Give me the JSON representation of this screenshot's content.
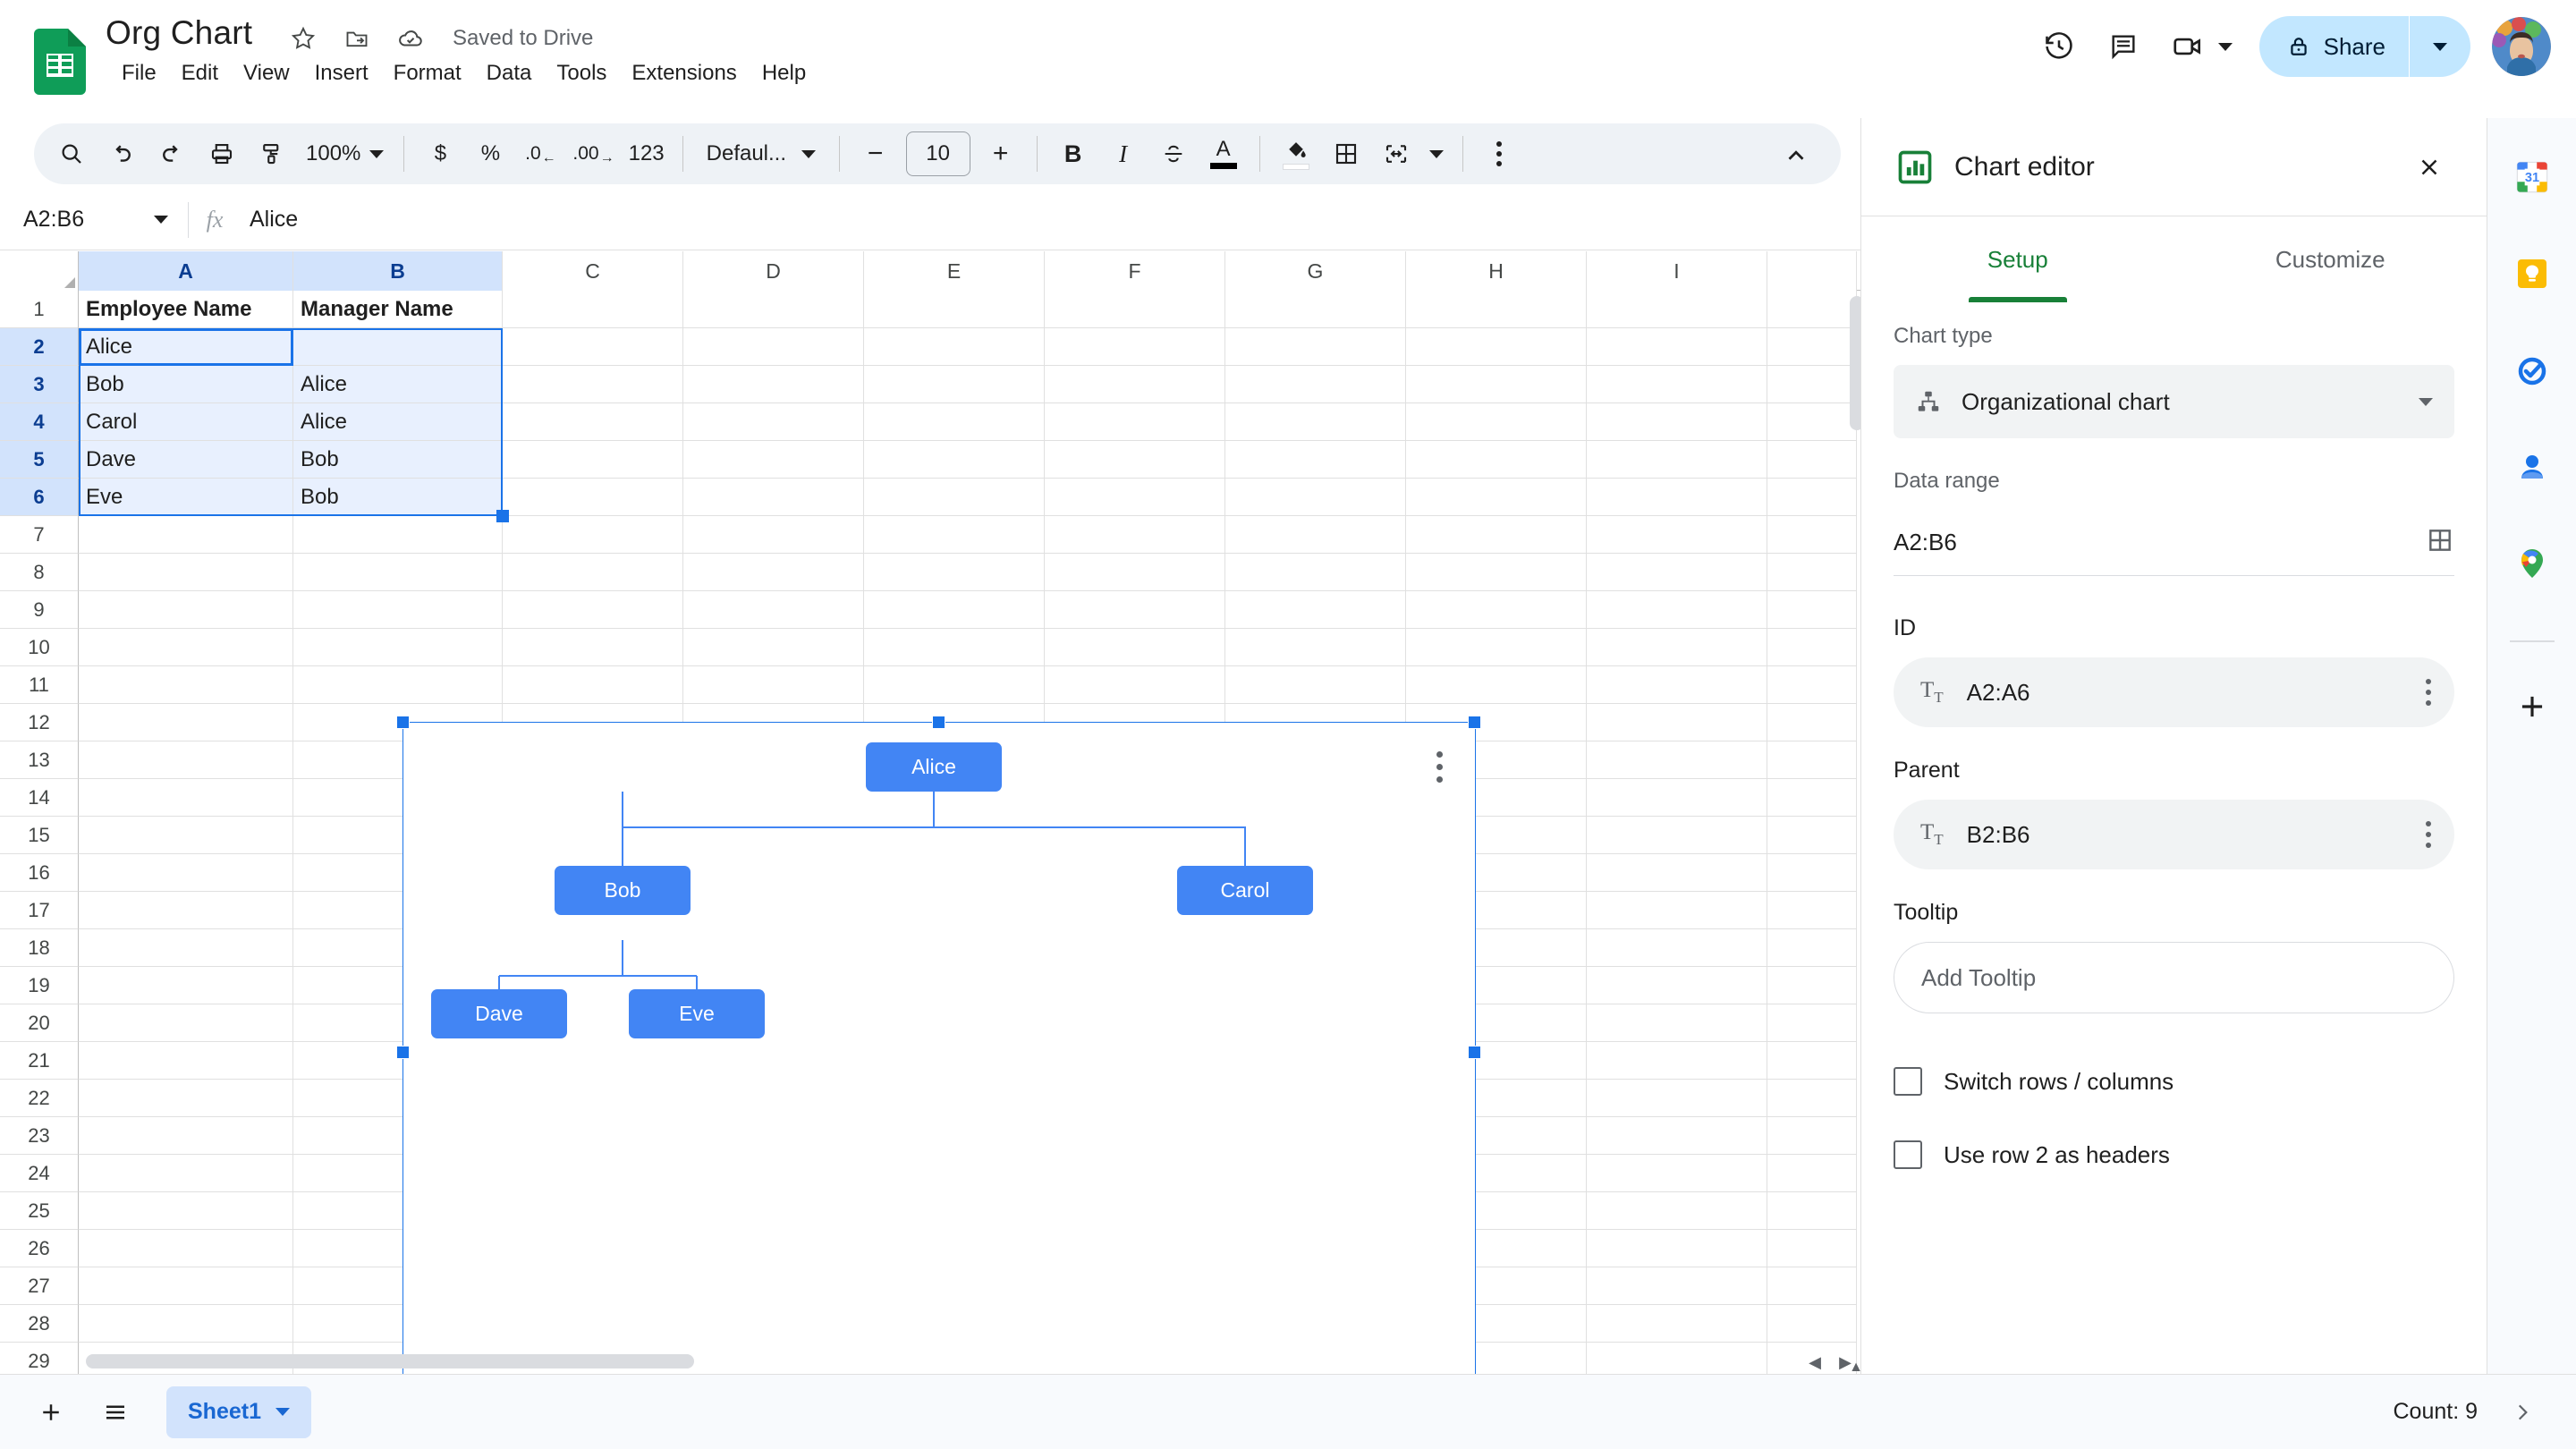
{
  "app": {
    "doc_title": "Org Chart",
    "save_status": "Saved to Drive",
    "logo_icon": "google-sheets-logo",
    "star_icon": "star-icon",
    "move_icon": "move-to-folder-icon",
    "cloud_icon": "cloud-saved-icon"
  },
  "menubar": {
    "items": [
      {
        "label": "File"
      },
      {
        "label": "Edit"
      },
      {
        "label": "View"
      },
      {
        "label": "Insert"
      },
      {
        "label": "Format"
      },
      {
        "label": "Data"
      },
      {
        "label": "Tools"
      },
      {
        "label": "Extensions"
      },
      {
        "label": "Help"
      }
    ]
  },
  "topright": {
    "history_icon": "version-history-icon",
    "comment_icon": "comment-icon",
    "meet_icon": "google-meet-icon",
    "share_lock_icon": "lock-icon",
    "share_label": "Share",
    "avatar_name": "user-avatar"
  },
  "toolbar": {
    "search_icon": "search-icon",
    "undo_icon": "undo-icon",
    "redo_icon": "redo-icon",
    "print_icon": "print-icon",
    "paint_icon": "paint-format-icon",
    "zoom_value": "100%",
    "currency_label": "$",
    "percent_label": "%",
    "dec_decimal_label": ".0",
    "inc_decimal_label": ".00",
    "number_format_label": "123",
    "font_name": "Defaul...",
    "font_decrease": "−",
    "font_size": "10",
    "font_increase": "+",
    "bold_label": "B",
    "italic_label": "I",
    "strike_icon": "strikethrough-icon",
    "text_color_label": "A",
    "fill_color_icon": "fill-color-icon",
    "borders_icon": "borders-icon",
    "merge_icon": "merge-cells-icon",
    "more_icon": "more-options-icon",
    "collapse_icon": "collapse-toolbar-icon"
  },
  "formula_bar": {
    "name_box": "A2:B6",
    "fx_label": "fx",
    "formula_value": "Alice"
  },
  "grid": {
    "columns": [
      "A",
      "B",
      "C",
      "D",
      "E",
      "F",
      "G",
      "H",
      "I"
    ],
    "selected_columns": [
      "A",
      "B"
    ],
    "rows": [
      1,
      2,
      3,
      4,
      5,
      6,
      7,
      8,
      9,
      10,
      11,
      12,
      13,
      14,
      15,
      16,
      17,
      18,
      19,
      20,
      21,
      22,
      23,
      24,
      25,
      26,
      27,
      28,
      29
    ],
    "selected_rows": [
      2,
      3,
      4,
      5,
      6
    ],
    "data": [
      {
        "row": 1,
        "A": "Employee Name",
        "B": "Manager Name",
        "bold": true
      },
      {
        "row": 2,
        "A": "Alice",
        "B": ""
      },
      {
        "row": 3,
        "A": "Bob",
        "B": "Alice"
      },
      {
        "row": 4,
        "A": "Carol",
        "B": "Alice"
      },
      {
        "row": 5,
        "A": "Dave",
        "B": "Bob"
      },
      {
        "row": 6,
        "A": "Eve",
        "B": "Bob"
      }
    ]
  },
  "chart_object": {
    "kebab_icon": "chart-options-icon",
    "selected": true
  },
  "chart_data": {
    "type": "diagram",
    "chart_kind": "organizational chart",
    "title": "",
    "nodes": [
      {
        "id": "Alice",
        "parent": "",
        "level": 0
      },
      {
        "id": "Bob",
        "parent": "Alice",
        "level": 1
      },
      {
        "id": "Carol",
        "parent": "Alice",
        "level": 1
      },
      {
        "id": "Dave",
        "parent": "Bob",
        "level": 2
      },
      {
        "id": "Eve",
        "parent": "Bob",
        "level": 2
      }
    ],
    "node_fill": "#4285f4",
    "node_text_color": "#ffffff",
    "edge_color": "#4285f4"
  },
  "panel": {
    "title": "Chart editor",
    "icon": "chart-editor-icon",
    "close_icon": "close-icon",
    "tabs": [
      {
        "label": "Setup",
        "active": true
      },
      {
        "label": "Customize",
        "active": false
      }
    ],
    "chart_type_label": "Chart type",
    "chart_type_value": "Organizational chart",
    "chart_type_icon": "org-chart-icon",
    "data_range_label": "Data range",
    "data_range_value": "A2:B6",
    "data_range_picker_icon": "select-range-icon",
    "id_label": "ID",
    "id_value": "A2:A6",
    "parent_label": "Parent",
    "parent_value": "B2:B6",
    "tooltip_label": "Tooltip",
    "add_tooltip_label": "Add Tooltip",
    "checkboxes": [
      {
        "label": "Switch rows / columns",
        "checked": false
      },
      {
        "label": "Use row 2 as headers",
        "checked": false
      }
    ]
  },
  "siderail": {
    "items": [
      {
        "name": "google-calendar-icon"
      },
      {
        "name": "google-keep-icon"
      },
      {
        "name": "google-tasks-icon"
      },
      {
        "name": "google-contacts-icon"
      },
      {
        "name": "google-maps-icon"
      }
    ],
    "add_label": "+",
    "add_name": "get-addons-icon"
  },
  "bottombar": {
    "add_sheet_icon": "add-sheet-icon",
    "all_sheets_icon": "all-sheets-icon",
    "sheet_name": "Sheet1",
    "sheet_caret_icon": "chevron-down-icon",
    "count_label": "Count: 9",
    "expand_icon": "expand-icon"
  },
  "colors": {
    "accent_blue": "#1a73e8",
    "node_blue": "#4285f4",
    "sheets_green": "#188038",
    "share_bg": "#c2e7ff",
    "selection_bg": "#e8f0fe",
    "header_sel_bg": "#d2e3fc"
  }
}
